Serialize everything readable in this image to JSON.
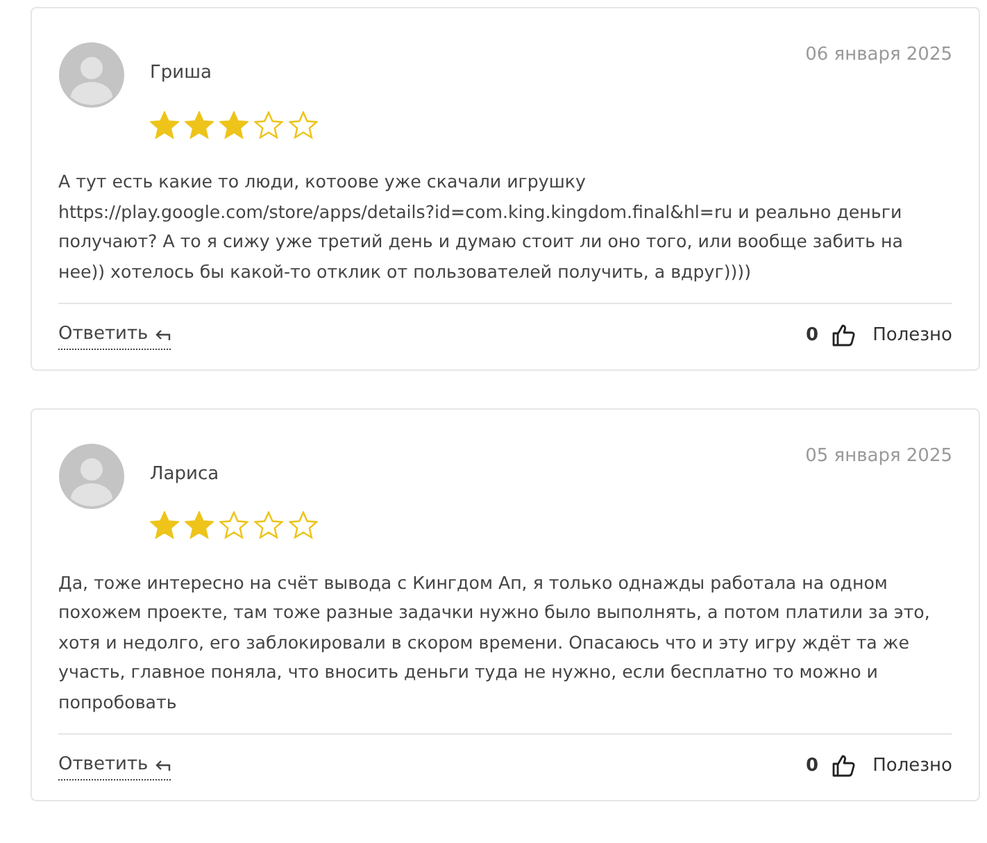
{
  "reviews": [
    {
      "author": "Гриша",
      "date": "06 января 2025",
      "stars": 3,
      "text": "А тут есть какие то люди, котоове уже скачали игрушку https://play.google.com/store/apps/details?id=com.king.kingdom.final&hl=ru и реально деньги получают? А то я сижу уже третий день и думаю стоит ли оно того, или вообще забить на нее)) хотелось бы какой-то отклик от пользователей получить, а вдруг))))",
      "reply": "Ответить",
      "likes": "0",
      "useful": "Полезно"
    },
    {
      "author": "Лариса",
      "date": "05 января 2025",
      "stars": 2,
      "text": "Да, тоже интересно на счёт вывода с Кингдом Ап, я только однажды работала на одном похожем проекте, там тоже разные задачки нужно было выполнять, а потом платили за это, хотя и недолго, его заблокировали в скором времени. Опасаюсь что и эту игру ждёт та же участь, главное поняла, что вносить деньги туда не нужно, если бесплатно то можно и попробовать",
      "reply": "Ответить",
      "likes": "0",
      "useful": "Полезно"
    }
  ]
}
